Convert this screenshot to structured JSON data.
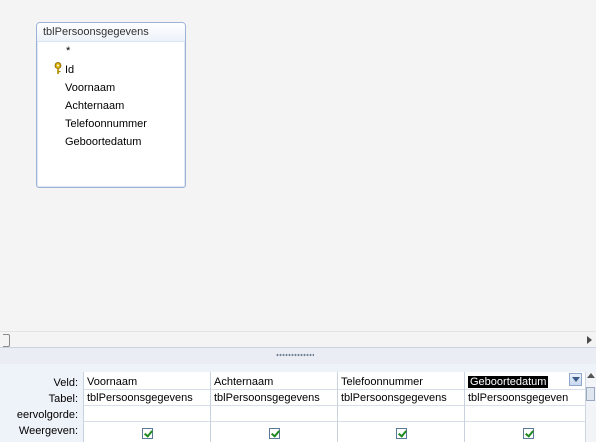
{
  "table": {
    "title": "tblPersoonsgegevens",
    "fields": [
      "*",
      "Id",
      "Voornaam",
      "Achternaam",
      "Telefoonnummer",
      "Geboortedatum"
    ],
    "primary_key": "Id"
  },
  "grid": {
    "row_labels": [
      "Veld:",
      "Tabel:",
      "eervolgorde:",
      "Weergeven:"
    ],
    "columns": [
      {
        "field": "Voornaam",
        "table": "tblPersoonsgegevens",
        "show": true
      },
      {
        "field": "Achternaam",
        "table": "tblPersoonsgegevens",
        "show": true
      },
      {
        "field": "Telefoonnummer",
        "table": "tblPersoonsgegevens",
        "show": true
      },
      {
        "field": "Geboortedatum",
        "table": "tblPersoonsgegeven",
        "show": true,
        "selected": true
      }
    ]
  },
  "colors": {
    "selection": "#000000",
    "checkmark": "#1f8a1f",
    "table_border": "#9db3d5"
  }
}
